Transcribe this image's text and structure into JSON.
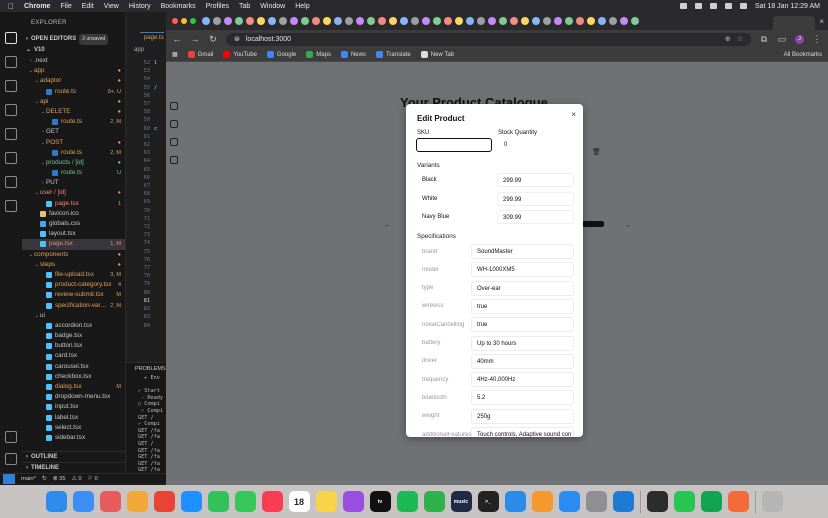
{
  "menubar": {
    "apple": "",
    "app": "Chrome",
    "items": [
      "File",
      "Edit",
      "View",
      "History",
      "Bookmarks",
      "Profiles",
      "Tab",
      "Window",
      "Help"
    ],
    "clock": "Sat 18 Jan  12:29 AM"
  },
  "vscode": {
    "explorer_title": "EXPLORER",
    "open_editors": "OPEN EDITORS",
    "unsaved": "2 unsaved",
    "root": "V10",
    "tree": [
      {
        "label": ".next",
        "depth": 1,
        "twisty": "›",
        "status": "",
        "color": "white",
        "icon": ""
      },
      {
        "label": "app",
        "depth": 1,
        "twisty": "⌄",
        "status": "●",
        "color": "orange",
        "icon": ""
      },
      {
        "label": "adaptor",
        "depth": 2,
        "twisty": "⌄",
        "status": "●",
        "color": "orange",
        "icon": ""
      },
      {
        "label": "route.ts",
        "depth": 3,
        "twisty": "",
        "status": "9+, U",
        "color": "orange",
        "icon": "#3178c6"
      },
      {
        "label": "api",
        "depth": 2,
        "twisty": "⌄",
        "status": "●",
        "color": "orange",
        "icon": ""
      },
      {
        "label": "DELETE",
        "depth": 3,
        "twisty": "⌄",
        "status": "●",
        "color": "orange",
        "icon": ""
      },
      {
        "label": "route.ts",
        "depth": 4,
        "twisty": "",
        "status": "2, M",
        "color": "orange",
        "icon": "#3178c6"
      },
      {
        "label": "GET",
        "depth": 3,
        "twisty": "›",
        "status": "",
        "color": "white",
        "icon": ""
      },
      {
        "label": "POST",
        "depth": 3,
        "twisty": "⌄",
        "status": "●",
        "color": "orange",
        "icon": ""
      },
      {
        "label": "route.ts",
        "depth": 4,
        "twisty": "",
        "status": "2, M",
        "color": "orange",
        "icon": "#3178c6"
      },
      {
        "label": "products / [id]",
        "depth": 3,
        "twisty": "⌄",
        "status": "●",
        "color": "green",
        "icon": ""
      },
      {
        "label": "route.ts",
        "depth": 4,
        "twisty": "",
        "status": "U",
        "color": "green",
        "icon": "#3178c6"
      },
      {
        "label": "PUT",
        "depth": 3,
        "twisty": "›",
        "status": "",
        "color": "white",
        "icon": ""
      },
      {
        "label": "user / [id]",
        "depth": 2,
        "twisty": "⌄",
        "status": "●",
        "color": "red",
        "icon": ""
      },
      {
        "label": "page.tsx",
        "depth": 3,
        "twisty": "",
        "status": "1",
        "color": "red",
        "icon": "#4fc1ff"
      },
      {
        "label": "favicon.ico",
        "depth": 2,
        "twisty": "",
        "status": "",
        "color": "white",
        "icon": "#e5c07b"
      },
      {
        "label": "globals.css",
        "depth": 2,
        "twisty": "",
        "status": "",
        "color": "white",
        "icon": "#42a5f5"
      },
      {
        "label": "layout.tsx",
        "depth": 2,
        "twisty": "",
        "status": "",
        "color": "white",
        "icon": "#4fc1ff"
      },
      {
        "label": "page.tsx",
        "depth": 2,
        "twisty": "",
        "status": "1, M",
        "color": "red",
        "icon": "#4fc1ff",
        "selected": true
      },
      {
        "label": "components",
        "depth": 1,
        "twisty": "⌄",
        "status": "●",
        "color": "orange",
        "icon": ""
      },
      {
        "label": "steps",
        "depth": 2,
        "twisty": "⌄",
        "status": "●",
        "color": "orange",
        "icon": ""
      },
      {
        "label": "file-upload.tsx",
        "depth": 3,
        "twisty": "",
        "status": "3, M",
        "color": "orange",
        "icon": "#4fc1ff"
      },
      {
        "label": "product-category.tsx",
        "depth": 3,
        "twisty": "",
        "status": "4",
        "color": "orange",
        "icon": "#4fc1ff"
      },
      {
        "label": "review-submit.tsx",
        "depth": 3,
        "twisty": "",
        "status": "M",
        "color": "orange",
        "icon": "#4fc1ff"
      },
      {
        "label": "specification-varie...",
        "depth": 3,
        "twisty": "",
        "status": "2, M",
        "color": "orange",
        "icon": "#4fc1ff"
      },
      {
        "label": "ui",
        "depth": 2,
        "twisty": "⌄",
        "status": "",
        "color": "white",
        "icon": ""
      },
      {
        "label": "accordion.tsx",
        "depth": 3,
        "twisty": "",
        "status": "",
        "color": "white",
        "icon": "#4fc1ff"
      },
      {
        "label": "badge.tsx",
        "depth": 3,
        "twisty": "",
        "status": "",
        "color": "white",
        "icon": "#4fc1ff"
      },
      {
        "label": "button.tsx",
        "depth": 3,
        "twisty": "",
        "status": "",
        "color": "white",
        "icon": "#4fc1ff"
      },
      {
        "label": "card.tsx",
        "depth": 3,
        "twisty": "",
        "status": "",
        "color": "white",
        "icon": "#4fc1ff"
      },
      {
        "label": "carousel.tsx",
        "depth": 3,
        "twisty": "",
        "status": "",
        "color": "white",
        "icon": "#4fc1ff"
      },
      {
        "label": "checkbox.tsx",
        "depth": 3,
        "twisty": "",
        "status": "",
        "color": "white",
        "icon": "#4fc1ff"
      },
      {
        "label": "dialog.tsx",
        "depth": 3,
        "twisty": "",
        "status": "M",
        "color": "orange",
        "icon": "#4fc1ff"
      },
      {
        "label": "dropdown-menu.tsx",
        "depth": 3,
        "twisty": "",
        "status": "",
        "color": "white",
        "icon": "#4fc1ff"
      },
      {
        "label": "input.tsx",
        "depth": 3,
        "twisty": "",
        "status": "",
        "color": "white",
        "icon": "#4fc1ff"
      },
      {
        "label": "label.tsx",
        "depth": 3,
        "twisty": "",
        "status": "",
        "color": "white",
        "icon": "#4fc1ff"
      },
      {
        "label": "select.tsx",
        "depth": 3,
        "twisty": "",
        "status": "",
        "color": "white",
        "icon": "#4fc1ff"
      },
      {
        "label": "sidebar.tsx",
        "depth": 3,
        "twisty": "",
        "status": "",
        "color": "white",
        "icon": "#4fc1ff"
      }
    ],
    "outline": "OUTLINE",
    "timeline": "TIMELINE",
    "editor_tab_active": "page.ts",
    "editor_tab_other": "app",
    "line_numbers": [
      "52",
      "53",
      "54",
      "55",
      "56",
      "57",
      "58",
      "59",
      "60",
      "61",
      "62",
      "63",
      "64",
      "65",
      "66",
      "67",
      "68",
      "69",
      "70",
      "71",
      "72",
      "73",
      "74",
      "75",
      "76",
      "77",
      "78",
      "79",
      "80",
      "81",
      "82",
      "83",
      "84"
    ],
    "current_line": "81",
    "code_fragments": [
      "l",
      "",
      "",
      "/",
      "",
      "",
      "",
      "",
      "c"
    ],
    "panel_title": "PROBLEMS",
    "terminal": "  ▸ Env\n\n✓ Start\n - Ready\n○ Compi\n ✓ Compi\nGET /\n✓ Compi\nGET /fa\nGET /fa\nGET /\nGET /fa\nGET /fa\nGET /fa\nGET /fa\nGET /fa\nGET /fa\n□",
    "status_branch": "main*",
    "status_sync": "↻",
    "status_errors": "⊗ 35",
    "status_warnings": "⚠ 0",
    "status_ports": "⚐ 0"
  },
  "browser": {
    "url": "localhost:3000",
    "bookmarks": [
      {
        "label": "Gmail",
        "color": "#ea4335"
      },
      {
        "label": "YouTube",
        "color": "#ff0000"
      },
      {
        "label": "Google",
        "color": "#4285f4"
      },
      {
        "label": "Maps",
        "color": "#34a853"
      },
      {
        "label": "News",
        "color": "#4285f4"
      },
      {
        "label": "Translate",
        "color": "#4285f4"
      },
      {
        "label": "New Tab",
        "color": "#dddddd"
      }
    ],
    "all_bookmarks": "All Bookmarks",
    "avatar_letter": "J",
    "tab_count": 40
  },
  "page": {
    "title": "Your Product Catalogue"
  },
  "dialog": {
    "title": "Edit Product",
    "close": "×",
    "sku_label": "SKU",
    "sku_value": "",
    "stock_label": "Stock Quantity",
    "stock_value": "0",
    "variants_label": "Variants",
    "variants": [
      {
        "name": "Black",
        "price": "299.99"
      },
      {
        "name": "White",
        "price": "299.99"
      },
      {
        "name": "Navy Blue",
        "price": "309.99"
      }
    ],
    "specs_label": "Specifications",
    "specs": [
      {
        "key": "brand",
        "value": "SoundMaster"
      },
      {
        "key": "model",
        "value": "WH-1000XM5"
      },
      {
        "key": "type",
        "value": "Over-ear"
      },
      {
        "key": "wireless",
        "value": "true"
      },
      {
        "key": "noiseCancelling",
        "value": "true"
      },
      {
        "key": "battery",
        "value": "Up to 30 hours"
      },
      {
        "key": "driver",
        "value": "40mm"
      },
      {
        "key": "frequency",
        "value": "4Hz-40,000Hz"
      },
      {
        "key": "bluetooth",
        "value": "5.2"
      },
      {
        "key": "weight",
        "value": "250g"
      },
      {
        "key": "additionalFeatures",
        "value": "Touch controls, Adaptive sound con"
      }
    ]
  },
  "dock": [
    {
      "name": "finder",
      "color": "#2d8ceb",
      "label": ""
    },
    {
      "name": "mail",
      "color": "#3a8ef5",
      "label": ""
    },
    {
      "name": "launchpad",
      "color": "#e65b5b",
      "label": ""
    },
    {
      "name": "photos",
      "color": "#f0a83a",
      "label": ""
    },
    {
      "name": "chrome",
      "color": "#e84335",
      "label": ""
    },
    {
      "name": "safari",
      "color": "#1e90ff",
      "label": ""
    },
    {
      "name": "facetime",
      "color": "#32c25a",
      "label": ""
    },
    {
      "name": "messages",
      "color": "#35c759",
      "label": ""
    },
    {
      "name": "music",
      "color": "#fa3c55",
      "label": ""
    },
    {
      "name": "calendar",
      "color": "#ffffff",
      "label": "18"
    },
    {
      "name": "notes",
      "color": "#f7d34a",
      "label": ""
    },
    {
      "name": "podcasts",
      "color": "#9b4de0",
      "label": ""
    },
    {
      "name": "appletv",
      "color": "#111111",
      "label": "tv"
    },
    {
      "name": "spotify",
      "color": "#1db954",
      "label": ""
    },
    {
      "name": "numbers",
      "color": "#2fb24a",
      "label": ""
    },
    {
      "name": "amazon-music",
      "color": "#1f2a44",
      "label": "music"
    },
    {
      "name": "terminal",
      "color": "#222222",
      "label": ">_"
    },
    {
      "name": "keynote",
      "color": "#2b8be8",
      "label": ""
    },
    {
      "name": "pages",
      "color": "#f39a2b",
      "label": ""
    },
    {
      "name": "app-store",
      "color": "#2a8cf0",
      "label": ""
    },
    {
      "name": "system-settings",
      "color": "#8e8e93",
      "label": ""
    },
    {
      "name": "vscode",
      "color": "#1e7bd3",
      "label": ""
    },
    {
      "name": "iterm",
      "color": "#2c2c2c",
      "label": ""
    },
    {
      "name": "whatsapp",
      "color": "#27c653",
      "label": ""
    },
    {
      "name": "mongodb-compass",
      "color": "#13a452",
      "label": ""
    },
    {
      "name": "postman",
      "color": "#f26b3a",
      "label": ""
    },
    {
      "name": "trash",
      "color": "#b5b5b5",
      "label": ""
    }
  ]
}
